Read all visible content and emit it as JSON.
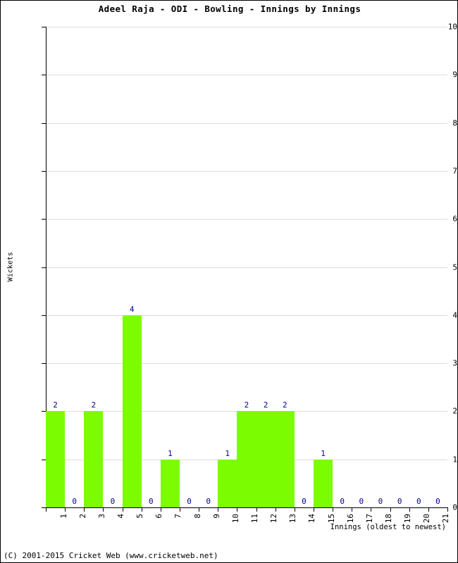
{
  "chart_data": {
    "type": "bar",
    "title": "Adeel Raja - ODI - Bowling - Innings by Innings",
    "xlabel": "Innings (oldest to newest)",
    "ylabel": "Wickets",
    "categories": [
      "1",
      "2",
      "3",
      "4",
      "5",
      "6",
      "7",
      "8",
      "9",
      "10",
      "11",
      "12",
      "13",
      "14",
      "15",
      "16",
      "17",
      "18",
      "19",
      "20",
      "21"
    ],
    "values": [
      2,
      0,
      2,
      0,
      4,
      0,
      1,
      0,
      0,
      1,
      2,
      2,
      2,
      0,
      1,
      0,
      0,
      0,
      0,
      0,
      0
    ],
    "value_labels": [
      "2",
      "0",
      "2",
      "0",
      "4",
      "0",
      "1",
      "0",
      "0",
      "1",
      "2",
      "2",
      "2",
      "0",
      "1",
      "0",
      "0",
      "0",
      "0",
      "0",
      "0"
    ],
    "ylim": [
      0,
      10
    ],
    "y_ticks": [
      0,
      1,
      2,
      3,
      4,
      5,
      6,
      7,
      8,
      9,
      10
    ],
    "y_tick_labels": [
      "0",
      "1",
      "2",
      "3",
      "4",
      "5",
      "6",
      "7",
      "8",
      "9",
      "10"
    ],
    "grid": true,
    "legend": "none",
    "bar_color": "#7CFC00",
    "value_label_color": "#00008B",
    "gridline_color": "#DDDDDD",
    "axis_color": "#000000"
  },
  "footer": {
    "copyright": "(C) 2001-2015 Cricket Web (www.cricketweb.net)"
  }
}
